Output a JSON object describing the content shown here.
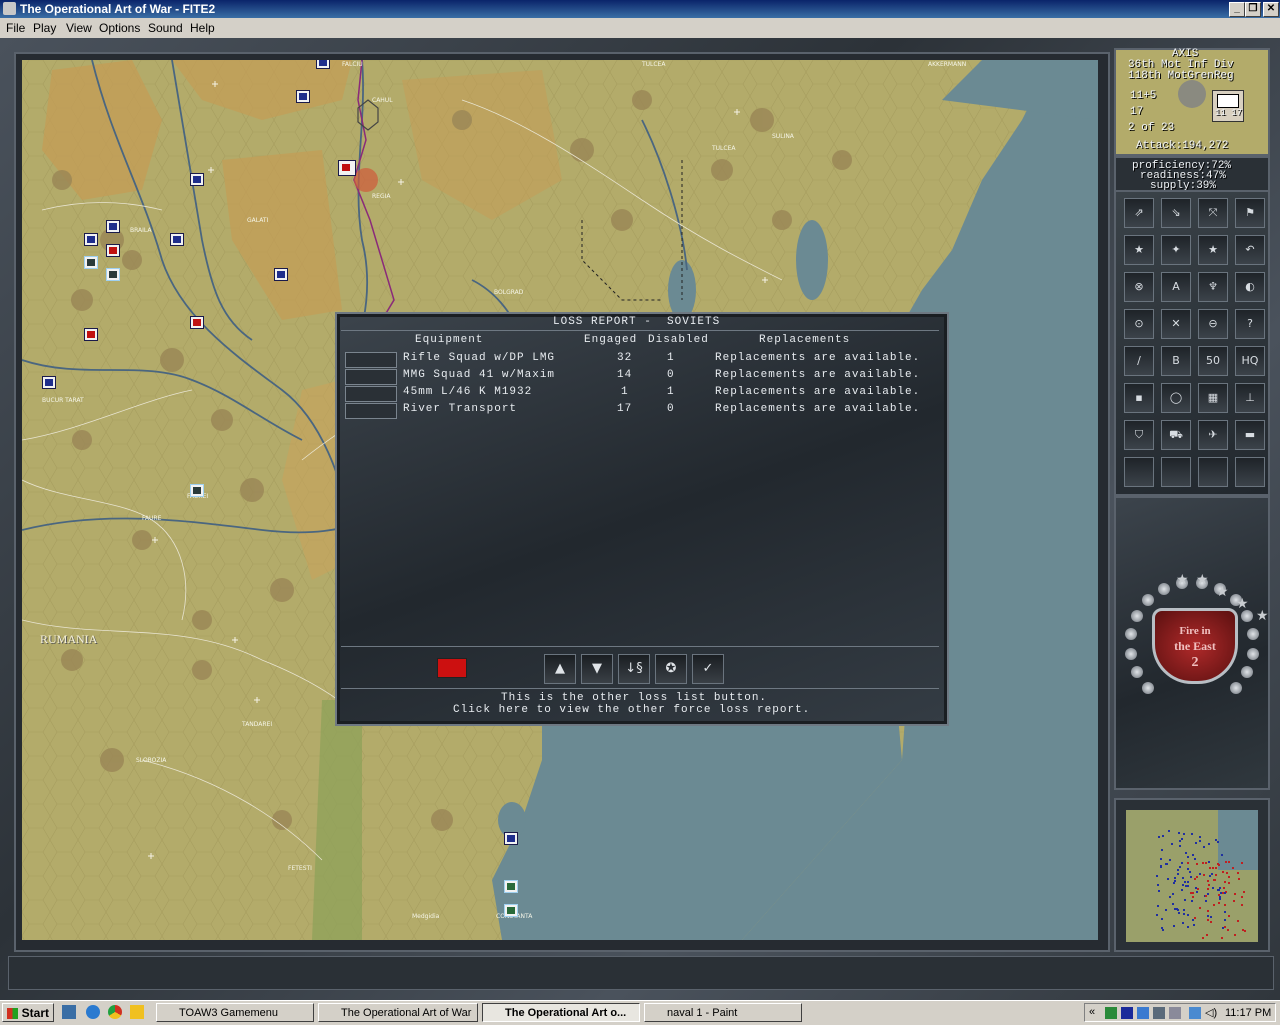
{
  "window": {
    "title": "The Operational Art of War - FITE2",
    "min": "_",
    "max": "❐",
    "close": "✕"
  },
  "menu": [
    "File",
    "Play",
    "View",
    "Options",
    "Sound",
    "Help"
  ],
  "map": {
    "labels": {
      "rumania": "RUMANIA"
    },
    "colors": {
      "land": "#b3ab6a",
      "sea": "#6b8a93",
      "hills": "#9a8a5a",
      "river": "#4a6680"
    }
  },
  "loss_report": {
    "title": "LOSS REPORT -  SOVIETS",
    "headers": {
      "equipment": "Equipment",
      "engaged": "Engaged",
      "disabled": "Disabled",
      "replacements": "Replacements"
    },
    "rows": [
      {
        "icon": "rifle-squad-icon",
        "name": "Rifle Squad w/DP LMG",
        "engaged": "32",
        "disabled": "1",
        "replacements": "Replacements are available."
      },
      {
        "icon": "mmg-squad-icon",
        "name": "MMG Squad 41 w/Maxim",
        "engaged": "14",
        "disabled": "0",
        "replacements": "Replacements are available."
      },
      {
        "icon": "antitank-gun-icon",
        "name": "45mm L/46 K M1932",
        "engaged": "1",
        "disabled": "1",
        "replacements": "Replacements are available."
      },
      {
        "icon": "river-transport-icon",
        "name": "River Transport",
        "engaged": "17",
        "disabled": "0",
        "replacements": "Replacements are available."
      }
    ],
    "buttons": {
      "up": "▲",
      "down": "▼",
      "sort": "↓§",
      "other_force": "✪",
      "ok": "✓"
    },
    "help_line1": "This is the other loss list button.",
    "help_line2": "Click here to view the other force loss report.",
    "flag_color": "#cc1010"
  },
  "unit_panel": {
    "side": "AXIS",
    "division": "36th Mot Inf Div",
    "regiment": "118th MotGrenReg",
    "strength": "11+5",
    "movement": "17",
    "count": "2 of 23",
    "attack": "Attack:194,272",
    "unit_label": "11 17",
    "proficiency": "proficiency:72%",
    "readiness": "readiness:47%",
    "supply": "supply:39%"
  },
  "command_buttons": [
    "move-up-icon",
    "move-down-icon",
    "expand-icon",
    "flag-icon",
    "star-left-icon",
    "star-right-icon",
    "star-icon",
    "undo-icon",
    "cancel-icon",
    "A",
    "bridge-icon",
    "halfmoon-icon",
    "target-icon",
    "swords-icon",
    "zoom-out-icon",
    "?",
    "pen-icon",
    "B",
    "50",
    "HQ",
    "square-icon",
    "circle-icon",
    "chart-icon",
    "tree-icon",
    "shield-icon",
    "truck-icon",
    "plane-icon",
    "tank-icon",
    "",
    "",
    "",
    ""
  ],
  "command_glyphs": [
    "⇗",
    "⇘",
    "⤧",
    "⚑",
    "★",
    "✦",
    "★",
    "↶",
    "⊗",
    "A",
    "♆",
    "◐",
    "⊙",
    "✕",
    "⊖",
    "?",
    "∕",
    "B",
    "50",
    "HQ",
    "▪",
    "◯",
    "▦",
    "⊥",
    "⛉",
    "⛟",
    "✈",
    "▬",
    "",
    "",
    "",
    ""
  ],
  "emblem": {
    "line1": "Fire in",
    "line2": "the East",
    "line3": "2"
  },
  "taskbar": {
    "start": "Start",
    "tasks": [
      {
        "label": "TOAW3 Gamemenu",
        "active": false
      },
      {
        "label": "The Operational Art of War",
        "active": false
      },
      {
        "label": "The Operational Art o...",
        "active": true
      },
      {
        "label": "naval 1 - Paint",
        "active": false
      }
    ],
    "clock": "11:17 PM"
  }
}
